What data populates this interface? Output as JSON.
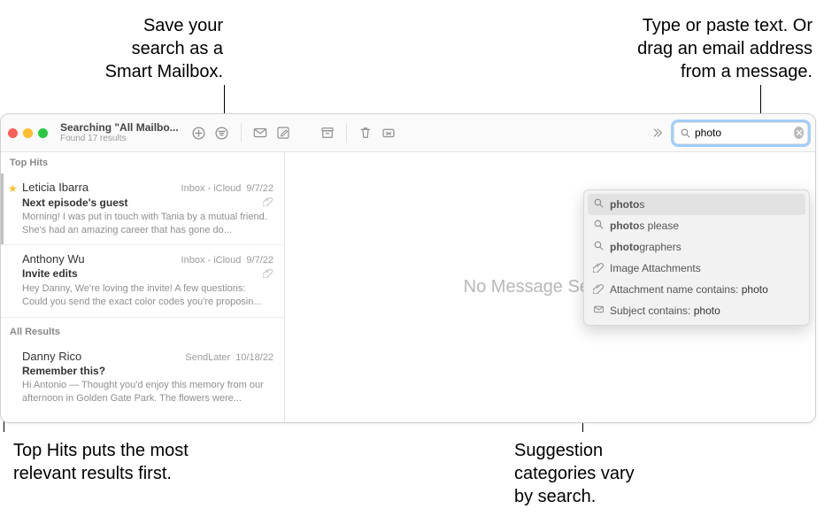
{
  "callouts": {
    "smart_mailbox": "Save your\nsearch as a\nSmart Mailbox.",
    "search_hint": "Type or paste text. Or\ndrag an email address\nfrom a message.",
    "top_hits": "Top Hits puts the most\nrelevant results first.",
    "suggestions": "Suggestion\ncategories vary\nby search."
  },
  "window": {
    "title": "Searching \"All Mailbo...",
    "subtitle": "Found 17 results"
  },
  "search": {
    "value": "photo"
  },
  "main": {
    "no_selection": "No Message Selected"
  },
  "sections": [
    {
      "label": "Top Hits",
      "messages": [
        {
          "star": true,
          "sender": "Leticia Ibarra",
          "mailbox": "Inbox - iCloud",
          "date": "9/7/22",
          "subject": "Next episode's guest",
          "attachment": true,
          "preview": "Morning! I was put in touch with Tania by a mutual friend. She's had an amazing career that has gone do..."
        },
        {
          "star": false,
          "sender": "Anthony Wu",
          "mailbox": "Inbox - iCloud",
          "date": "9/7/22",
          "subject": "Invite edits",
          "attachment": true,
          "preview": "Hey Danny, We're loving the invite! A few questions: Could you send the exact color codes you're proposin..."
        }
      ]
    },
    {
      "label": "All Results",
      "messages": [
        {
          "star": false,
          "sender": "Danny Rico",
          "mailbox": "SendLater",
          "date": "10/18/22",
          "subject": "Remember this?",
          "attachment": false,
          "preview": "Hi Antonio — Thought you'd enjoy this memory from our afternoon in Golden Gate Park. The flowers were..."
        }
      ]
    }
  ],
  "suggestions": [
    {
      "icon": "search-icon",
      "html": "<span class='bold'>photo</span>s"
    },
    {
      "icon": "search-icon",
      "html": "<span class='bold'>photo</span>s please"
    },
    {
      "icon": "search-icon",
      "html": "<span class='bold'>photo</span>graphers"
    },
    {
      "icon": "attachment-icon",
      "html": "Image Attachments"
    },
    {
      "icon": "attachment-icon",
      "html": "Attachment name contains: <span class='val'>photo</span>"
    },
    {
      "icon": "envelope-icon",
      "html": "Subject contains: <span class='val'>photo</span>"
    }
  ]
}
